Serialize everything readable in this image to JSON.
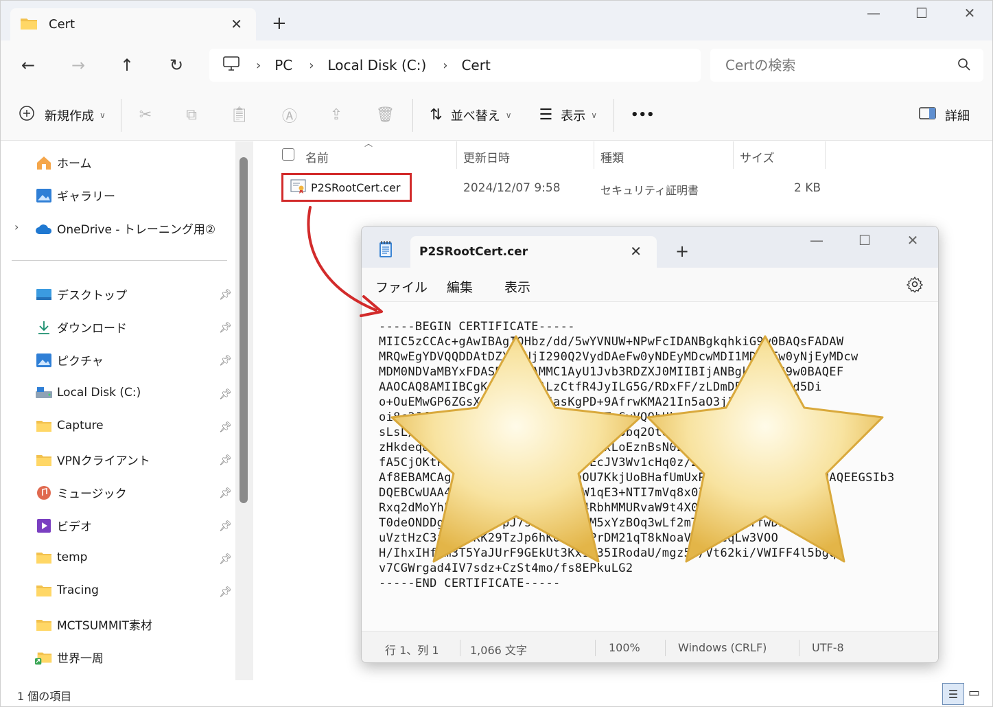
{
  "explorer": {
    "tab_title": "Cert",
    "address": {
      "pc": "PC",
      "disk": "Local Disk (C:)",
      "folder": "Cert"
    },
    "search_placeholder": "Certの検索",
    "toolbar": {
      "new": "新規作成",
      "sort": "並べ替え",
      "view": "表示",
      "more": "•••",
      "details": "詳細"
    },
    "sidebar": {
      "top": [
        {
          "label": "ホーム"
        },
        {
          "label": "ギャラリー"
        },
        {
          "label": "OneDrive - トレーニング用②"
        }
      ],
      "quick": [
        {
          "label": "デスクトップ"
        },
        {
          "label": "ダウンロード"
        },
        {
          "label": "ピクチャ"
        },
        {
          "label": "Local Disk (C:)"
        },
        {
          "label": "Capture"
        },
        {
          "label": "VPNクライアント"
        },
        {
          "label": "ミュージック"
        },
        {
          "label": "ビデオ"
        },
        {
          "label": "temp"
        },
        {
          "label": "Tracing"
        },
        {
          "label": "MCTSUMMIT素材"
        },
        {
          "label": "世界一周"
        }
      ]
    },
    "columns": {
      "name": "名前",
      "modified": "更新日時",
      "type": "種類",
      "size": "サイズ"
    },
    "file": {
      "name": "P2SRootCert.cer",
      "modified": "2024/12/07 9:58",
      "type": "セキュリティ証明書",
      "size": "2 KB"
    },
    "status": "1 個の項目"
  },
  "notepad": {
    "tab_title": "P2SRootCert.cer",
    "menu": {
      "file": "ファイル",
      "edit": "編集",
      "view": "表示"
    },
    "content": "-----BEGIN CERTIFICATE-----\nMIIC5zCCAc+gAwIBAgIQHbz/dd/5wYVNUW+NPwFcIDANBgkqhkiG9w0BAQsFADAW\nMRQwEgYDVQQDDAtDZXJ0UjI290Q2VydDAeFw0yNDEyMDcwMDI1MDVaFw0yNjEyMDcw\nMDM0NDVaMBYxFDASBgNVBAMMC1AyU1Jvb3RDZXJ0MIIBIjANBgkqhkiG9w0BAQEF\nAAOCAQ8AMIIBCgKCAQEAiDALzCtfR4JyILG5G/RDxFF/zLDmDE5J0fztyd5Di\no+OuEMwGP6ZGsXtjw9wJEI/JasKgPD+9AfrwKMA21In5aO3j1+YGBwmqZY\noi8c3Jfd8xq7nX9ZQaaT0PqLk2Vv8ybTeGvVQQbUkn6dX2gZk3PPUf1c+v\nsLsL/zUN8kQh7p0Vd5nV2oqXd3sa2NqlX8bq2Ot8mpCrxa6D0sxJfM6TtI\nzHkdeqaxPyRv4Jt2dR3mlQ9q0Mt4lzPxLoEznBsN0ZtlD3nVCw0R1Ql4sQ\nfA5CjOKtPq2w0vXyGd4cJ9lQeE+MTEcJV3Wv1cHq0z/2NrlkYdKmY8vQ8B\nAf8EBAMCAgQwHQYDVR0OBBYEFVUoOU7KkjUoBHafUmUxR9Lc0wDQYJKoZIhvcNAQEEGSIb3\nDQEBCwUAA4IBAQBp6XkzQyLHQwtTW1qE3+NTI7mVq8x0Zbe2yrC3Nd0EXSI\nRxq2dMoYhPqR0zE7Hk5wJ2PEAdS64RbhMMURvaW9t4X0fVc1Kpd8Uq2nl1\nT0deONDDgQ0x1vRk8pJ7sN3VbbkEZM5xYzBOq3wLf2mT8uHcR9nYfwDL\nuVztHzC3fGq2nKK29TzJp6hKUABpUPrDM21qT8kNoaV24mQCqLw3VOO\nH/IhxIHfQm3T5YaJUrF9GEkUt3Kx1R35IRodaU/mgz5//Vt62ki/VWIFF4l5bgq\nv7CGWrgad4IV7sdz+CzSt4mo/fs8EPkuLG2\n-----END CERTIFICATE-----",
    "status": {
      "position": "行 1、列 1",
      "chars": "1,066 文字",
      "zoom": "100%",
      "eol": "Windows (CRLF)",
      "encoding": "UTF-8"
    }
  },
  "colors": {
    "highlight": "#d22b2b",
    "arrow": "#d22b2b",
    "star": "#f1cf6a"
  }
}
